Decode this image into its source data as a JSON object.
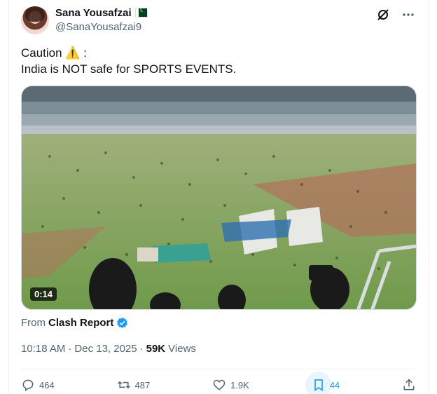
{
  "author": {
    "display_name": "Sana Yousafzai",
    "handle": "@SanaYousafzai9",
    "flag": "pakistan-flag"
  },
  "tweet": {
    "line1": "Caution ⚠️ :",
    "line2": "India is NOT safe for SPORTS EVENTS."
  },
  "media": {
    "duration": "0:14"
  },
  "source": {
    "prefix": "From",
    "name": "Clash Report"
  },
  "meta": {
    "time": "10:18 AM",
    "separator": "·",
    "date": "Dec 13, 2025",
    "views_count": "59K",
    "views_label": "Views"
  },
  "actions": {
    "replies": "464",
    "reposts": "487",
    "likes": "1.9K",
    "bookmarks": "44"
  },
  "colors": {
    "accent": "#1d9bf0",
    "secondary_text": "#536471"
  }
}
